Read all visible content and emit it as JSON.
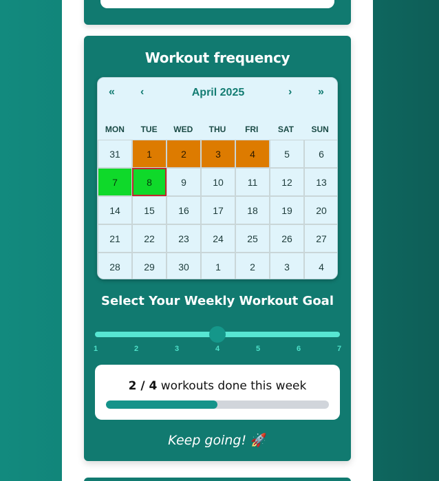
{
  "card": {
    "title": "Workout frequency"
  },
  "calendar": {
    "label": "April 2025",
    "nav": {
      "prev2": "«",
      "prev": "‹",
      "next": "›",
      "next2": "»"
    },
    "weekdays": [
      "MON",
      "TUE",
      "WED",
      "THU",
      "FRI",
      "SAT",
      "SUN"
    ],
    "days": [
      {
        "label": "31",
        "state": "other"
      },
      {
        "label": "1",
        "state": "streak"
      },
      {
        "label": "2",
        "state": "streak"
      },
      {
        "label": "3",
        "state": "streak"
      },
      {
        "label": "4",
        "state": "streak"
      },
      {
        "label": "5",
        "state": "normal"
      },
      {
        "label": "6",
        "state": "normal"
      },
      {
        "label": "7",
        "state": "done"
      },
      {
        "label": "8",
        "state": "done-today"
      },
      {
        "label": "9",
        "state": "normal"
      },
      {
        "label": "10",
        "state": "normal"
      },
      {
        "label": "11",
        "state": "normal"
      },
      {
        "label": "12",
        "state": "normal"
      },
      {
        "label": "13",
        "state": "normal"
      },
      {
        "label": "14",
        "state": "normal"
      },
      {
        "label": "15",
        "state": "normal"
      },
      {
        "label": "16",
        "state": "normal"
      },
      {
        "label": "17",
        "state": "normal"
      },
      {
        "label": "18",
        "state": "normal"
      },
      {
        "label": "19",
        "state": "normal"
      },
      {
        "label": "20",
        "state": "normal"
      },
      {
        "label": "21",
        "state": "normal"
      },
      {
        "label": "22",
        "state": "normal"
      },
      {
        "label": "23",
        "state": "normal"
      },
      {
        "label": "24",
        "state": "normal"
      },
      {
        "label": "25",
        "state": "normal"
      },
      {
        "label": "26",
        "state": "normal"
      },
      {
        "label": "27",
        "state": "normal"
      },
      {
        "label": "28",
        "state": "normal"
      },
      {
        "label": "29",
        "state": "normal"
      },
      {
        "label": "30",
        "state": "normal"
      },
      {
        "label": "1",
        "state": "other"
      },
      {
        "label": "2",
        "state": "other"
      },
      {
        "label": "3",
        "state": "other"
      },
      {
        "label": "4",
        "state": "other"
      }
    ]
  },
  "goal": {
    "title": "Select Your Weekly Workout Goal",
    "min": 1,
    "max": 7,
    "value": 4,
    "ticks": [
      "1",
      "2",
      "3",
      "4",
      "5",
      "6",
      "7"
    ]
  },
  "progress": {
    "done": "2",
    "separator": " / ",
    "goal": "4",
    "suffix": " workouts done this week",
    "fraction": 0.5
  },
  "encouragement": {
    "text": "Keep going!",
    "emoji": "🚀"
  },
  "colors": {
    "card_bg": "#117a70",
    "streak": "#dd7b00",
    "done": "#0fd92a",
    "today_outline": "#c0262d",
    "slider_track": "#57e6d2",
    "accent": "#15938a"
  }
}
